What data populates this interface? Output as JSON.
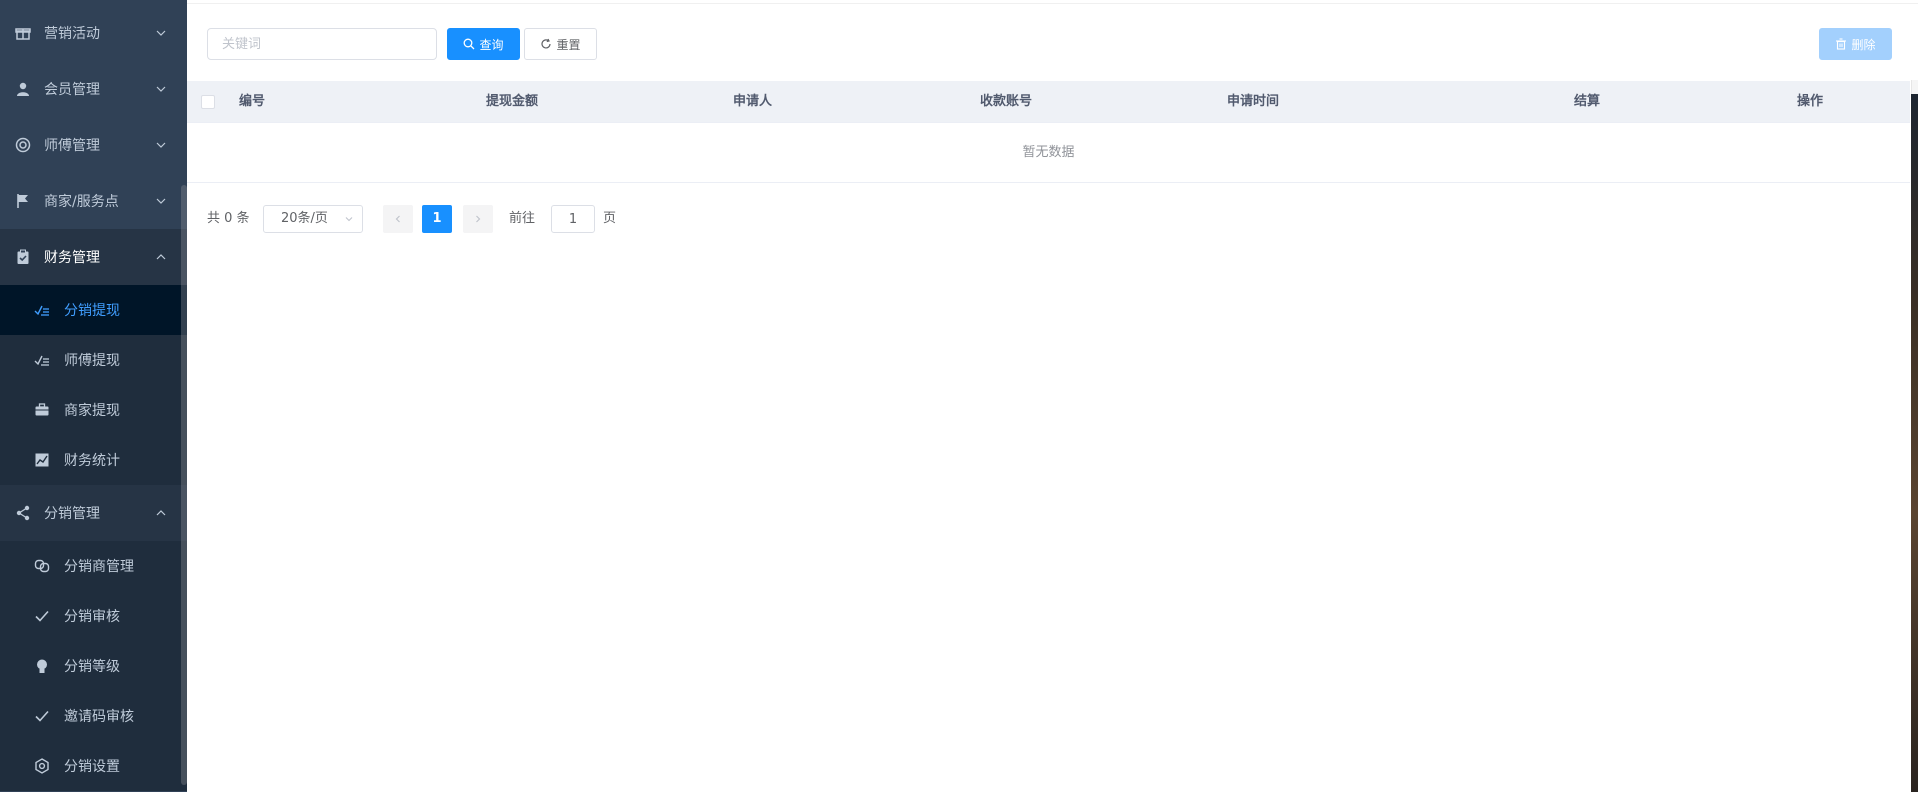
{
  "sidebar": {
    "groups": [
      {
        "label": "营销活动",
        "icon": "gift-icon",
        "expanded": false
      },
      {
        "label": "会员管理",
        "icon": "user-icon",
        "expanded": false
      },
      {
        "label": "师傅管理",
        "icon": "lifebuoy-icon",
        "expanded": false
      },
      {
        "label": "商家/服务点",
        "icon": "flag-icon",
        "expanded": false
      },
      {
        "label": "财务管理",
        "icon": "clipboard-check-icon",
        "expanded": true
      },
      {
        "label": "分销管理",
        "icon": "share-icon",
        "expanded": true
      }
    ],
    "finance_items": [
      {
        "label": "分销提现",
        "icon": "checklist-icon",
        "active": true
      },
      {
        "label": "师傅提现",
        "icon": "checklist-icon",
        "active": false
      },
      {
        "label": "商家提现",
        "icon": "briefcase-icon",
        "active": false
      },
      {
        "label": "财务统计",
        "icon": "chart-icon",
        "active": false
      }
    ],
    "distribution_items": [
      {
        "label": "分销商管理",
        "icon": "link-icon"
      },
      {
        "label": "分销审核",
        "icon": "check-icon"
      },
      {
        "label": "分销等级",
        "icon": "bulb-icon"
      },
      {
        "label": "邀请码审核",
        "icon": "check-icon"
      },
      {
        "label": "分销设置",
        "icon": "gear-icon"
      }
    ]
  },
  "toolbar": {
    "search_placeholder": "关键词",
    "query_label": "查询",
    "reset_label": "重置",
    "delete_label": "删除"
  },
  "table": {
    "columns": [
      "编号",
      "提现金额",
      "申请人",
      "收款账号",
      "申请时间",
      "结算",
      "操作"
    ],
    "empty_text": "暂无数据"
  },
  "pagination": {
    "total_text": "共 0 条",
    "page_size": "20条/页",
    "current_page": "1",
    "goto_label": "前往",
    "goto_value": "1",
    "page_suffix": "页"
  },
  "colors": {
    "sidebar_bg": "#304156",
    "active_text": "#409eff",
    "primary": "#1890ff"
  }
}
